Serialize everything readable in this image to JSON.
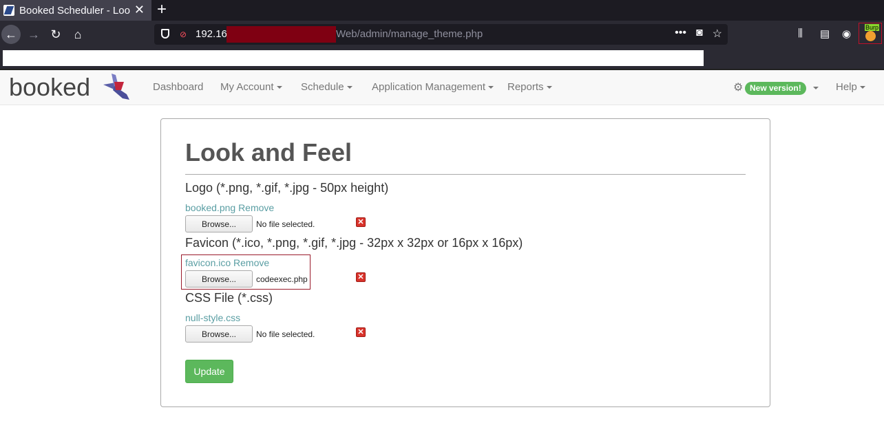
{
  "browser": {
    "tab_title": "Booked Scheduler - Look",
    "url_host": "192.16",
    "url_path": "Web/admin/manage_theme.php",
    "burp_label": "Burp"
  },
  "site": {
    "logo_text": "booked",
    "nav": {
      "dashboard": "Dashboard",
      "my_account": "My Account",
      "schedule": "Schedule",
      "app_management": "Application Management",
      "reports": "Reports",
      "new_version": "New version!",
      "help": "Help"
    }
  },
  "page": {
    "title": "Look and Feel",
    "logo_section": {
      "label": "Logo (*.png, *.gif, *.jpg - 50px height)",
      "link": "booked.png Remove",
      "browse": "Browse...",
      "status": "No file selected."
    },
    "favicon_section": {
      "label": "Favicon (*.ico, *.png, *.gif, *.jpg - 32px x 32px or 16px x 16px)",
      "link": "favicon.ico Remove",
      "browse": "Browse...",
      "status": "codeexec.php"
    },
    "css_section": {
      "label": "CSS File (*.css)",
      "link": "null-style.css",
      "browse": "Browse...",
      "status": "No file selected."
    },
    "update_button": "Update"
  },
  "colors": {
    "update_green": "#5cb85c",
    "link_teal": "#5a9ea3",
    "delete_red": "#d9332b"
  }
}
